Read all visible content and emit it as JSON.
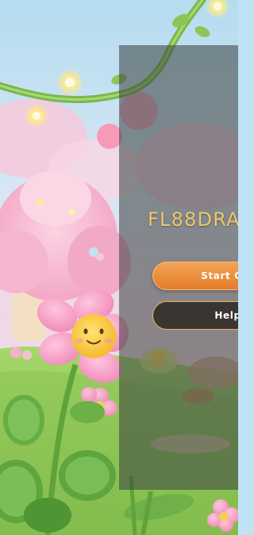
{
  "game": {
    "title": "FL88DRA"
  },
  "menu": {
    "start_label": "Start Gar",
    "help_label": "Help"
  },
  "colors": {
    "title": "#f2c66a",
    "start_button": "#e88a3a",
    "help_border": "#e6b25e",
    "overlay": "#3a4240"
  }
}
